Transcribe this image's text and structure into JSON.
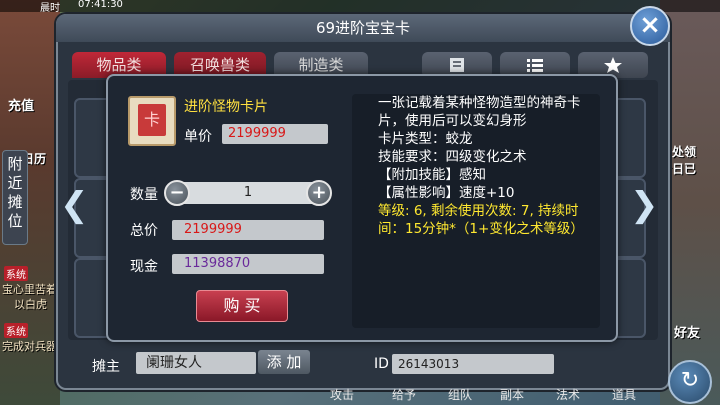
{
  "status_bar": {
    "time_label": "晨时",
    "time": "07:41:30"
  },
  "left_side": {
    "recharge": "充值",
    "calendar": "日历",
    "nearby_stall": "附近摊位",
    "tag1": "系统",
    "msg1": "宝心里苦着",
    "msg2": "以白虎",
    "tag2": "系统",
    "msg3": "完成对兵器"
  },
  "right_side": {
    "msg1": "处领",
    "msg2": "今日已",
    "friends": "好友"
  },
  "window": {
    "title": "69进阶宝宝卡",
    "close_icon": "×",
    "tabs": [
      {
        "label": "物品类"
      },
      {
        "label": "召唤兽类"
      },
      {
        "label": "制造类"
      }
    ],
    "seller_label": "摊主",
    "seller_name": "阑珊女人",
    "add_button": "添 加",
    "id_label": "ID",
    "id_value": "26143013"
  },
  "bottom_bar": {
    "items": [
      "攻击",
      "给予",
      "组队",
      "副本",
      "法术",
      "道具"
    ]
  },
  "dialog": {
    "item_name": "进阶怪物卡片",
    "unit_price_label": "单价",
    "unit_price": "2199999",
    "quantity_label": "数量",
    "quantity": "1",
    "minus_icon": "−",
    "plus_icon": "+",
    "total_label": "总价",
    "total_price": "2199999",
    "cash_label": "现金",
    "cash": "11398870",
    "buy_button": "购 买",
    "description": {
      "line1": "一张记载着某种怪物造型的神奇卡片，使用后可以变幻身形",
      "line2": "卡片类型：蛟龙",
      "line3": "技能要求：四级变化之术",
      "line4": "【附加技能】感知",
      "line5": "【属性影响】速度+10",
      "line6": "等级: 6, 剩余使用次数: 7, 持续时间：15分钟*（1+变化之术等级）"
    }
  },
  "colors": {
    "price_red": "#d81818",
    "cash_purple": "#6a2a9a",
    "item_name_yellow": "#ffe040"
  }
}
